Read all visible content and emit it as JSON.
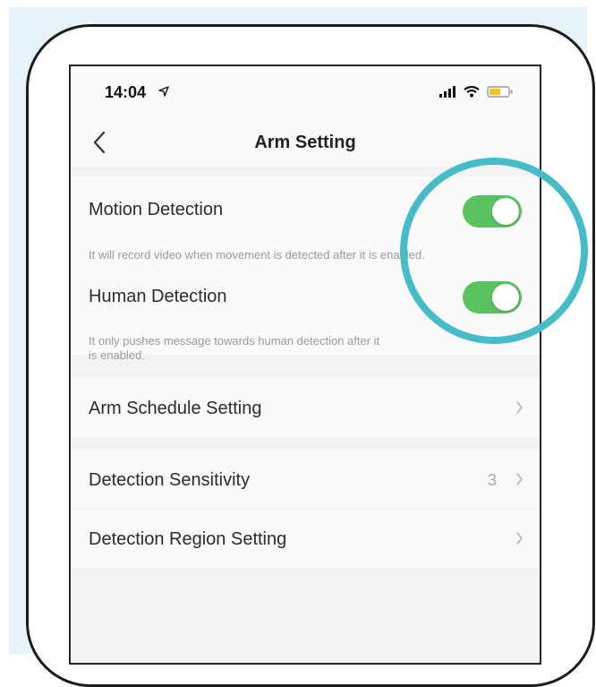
{
  "status": {
    "time": "14:04",
    "icons": [
      "location-arrow-icon",
      "signal-icon",
      "wifi-icon",
      "battery-icon"
    ]
  },
  "nav": {
    "title": "Arm Setting",
    "back_icon": "chevron-left-icon"
  },
  "settings": [
    {
      "label": "Motion Detection",
      "toggle_on": true,
      "description": "It will record video when movement is detected after it is enabled."
    },
    {
      "label": "Human Detection",
      "toggle_on": true,
      "description_lines": [
        "It only pushes message towards human detection after it",
        "is enabled."
      ]
    },
    {
      "label": "Arm Schedule Setting"
    },
    {
      "label": "Detection Sensitivity",
      "value": "3"
    },
    {
      "label": "Detection Region Setting"
    }
  ],
  "colors": {
    "toggle_on": "#5ac35f",
    "highlight_circle": "#45bcc8",
    "panel_background": "#e7f3fa"
  }
}
